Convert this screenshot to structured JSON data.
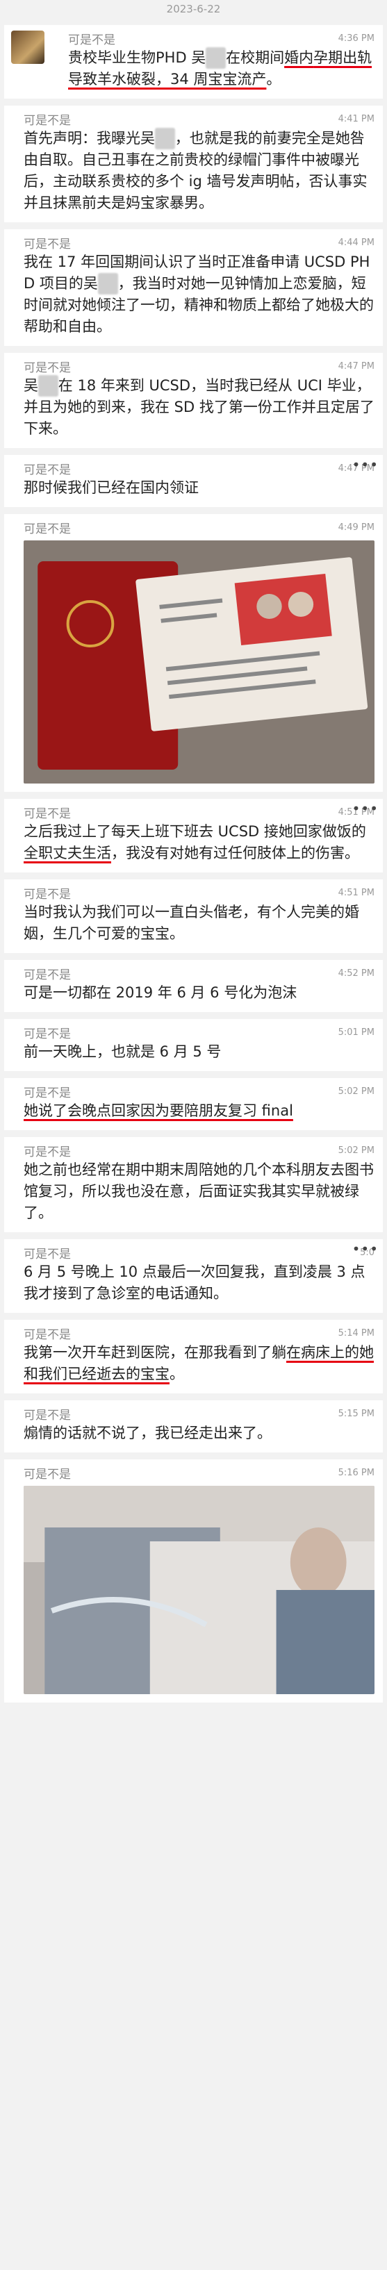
{
  "date_header": "2023-6-22",
  "sender": "可是不是",
  "posts": [
    {
      "time": "4:36 PM",
      "html_segments": [
        {
          "t": "贵校毕业生物PHD 吴"
        },
        {
          "t": "XX",
          "blur": true
        },
        {
          "t": "在校期间"
        },
        {
          "t": "婚内",
          "ul": true
        },
        {
          "t": "孕期出轨导致羊水破裂，34 周宝宝流产",
          "ul": true
        },
        {
          "t": "。"
        }
      ]
    },
    {
      "time": "4:41 PM",
      "html_segments": [
        {
          "t": "首先声明：我曝光吴"
        },
        {
          "t": "XX",
          "blur": true
        },
        {
          "t": "，也就是我的前妻完全是她咎由自取。自己丑事在之前贵校的绿帽门事件中被曝光后，主动联系贵校的多个 ig 墙号发声明帖，否认事实并且抹黑前夫是妈宝家暴男。"
        }
      ]
    },
    {
      "time": "4:44 PM",
      "html_segments": [
        {
          "t": "我在 17 年回国期间认识了当时正准备申请 UCSD PHD 项目的吴"
        },
        {
          "t": "XX",
          "blur": true
        },
        {
          "t": "，我当时对她一见钟情加上恋爱脑，短时间就对她倾注了一切，精神和物质上都给了她极大的帮助和自由。"
        }
      ]
    },
    {
      "time": "4:47 PM",
      "html_segments": [
        {
          "t": "吴"
        },
        {
          "t": "XX",
          "blur": true
        },
        {
          "t": "在 18 年来到 UCSD，当时我已经从 UCI 毕业，并且为她的到来，我在 SD 找了第一份工作并且定居了下来。"
        }
      ]
    },
    {
      "time": "4:47 PM",
      "more": true,
      "html_segments": [
        {
          "t": "那时候我们已经在国内领证"
        }
      ]
    },
    {
      "time": "4:49 PM",
      "photo": "marriage",
      "html_segments": []
    },
    {
      "time": "4:51 PM",
      "more": true,
      "html_segments": [
        {
          "t": "之后我过上了每天上班下班去 UCSD 接她回家做饭的"
        },
        {
          "t": "全职丈夫生活",
          "ul": true
        },
        {
          "t": "，我没有对她有过任何肢体上的伤害。"
        }
      ]
    },
    {
      "time": "4:51 PM",
      "html_segments": [
        {
          "t": "当时我认为我们可以一直白头偕老，有个人完美的婚姻，生几个可爱的宝宝。"
        }
      ]
    },
    {
      "time": "4:52 PM",
      "html_segments": [
        {
          "t": "可是一切都在 2019 年 6 月 6 号化为泡沫"
        }
      ]
    },
    {
      "time": "5:01 PM",
      "html_segments": [
        {
          "t": "前一天晚上，也就是 6 月 5 号"
        }
      ]
    },
    {
      "time": "5:02 PM",
      "html_segments": [
        {
          "t": "她说了会晚点回家因为要陪朋友复习 final",
          "ul": true
        }
      ]
    },
    {
      "time": "5:02 PM",
      "html_segments": [
        {
          "t": "她之前也经常在期中期末周陪她的几个本科朋友去图书馆复习，所以我也没在意，后面证实我其实早就被绿了。"
        }
      ]
    },
    {
      "time": "5:0",
      "more": true,
      "html_segments": [
        {
          "t": "6 月 5 号晚上 10 点最后一次回复我，直到凌晨 3 点我才接到了急诊室的电话通知。"
        }
      ]
    },
    {
      "time": "5:14 PM",
      "html_segments": [
        {
          "t": "我第一次开车赶到医院，在那我看到了躺"
        },
        {
          "t": "在病床上的她和我们已经逝去的宝宝",
          "ul": true
        },
        {
          "t": "。"
        }
      ]
    },
    {
      "time": "5:15 PM",
      "html_segments": [
        {
          "t": "煽情的话就不说了，我已经走出来了。"
        }
      ]
    },
    {
      "time": "5:16 PM",
      "photo": "hospital",
      "html_segments": []
    }
  ],
  "icons": {
    "more": "more-dots-icon",
    "avatar": "avatar"
  },
  "colors": {
    "underline": "#e60012",
    "background": "#f2f2f2"
  }
}
